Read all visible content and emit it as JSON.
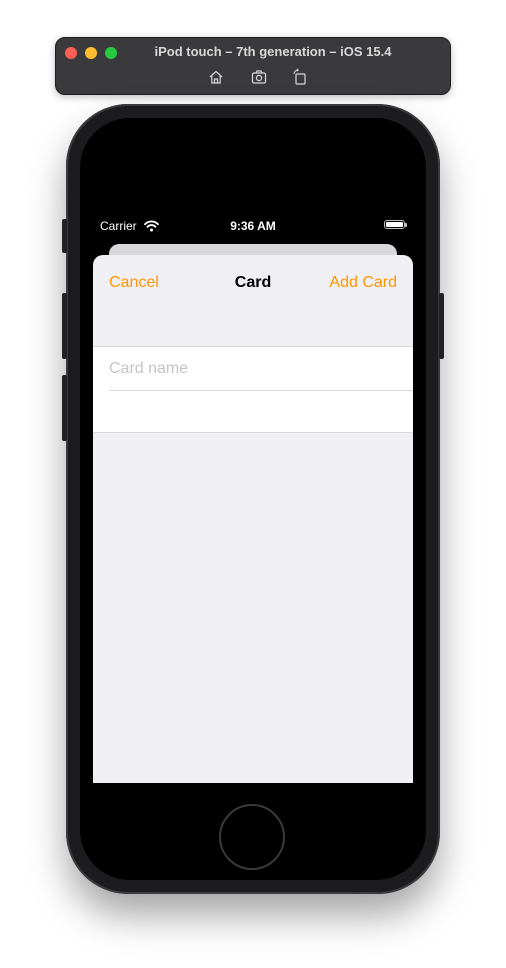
{
  "simulator": {
    "title": "iPod touch – 7th generation – iOS 15.4",
    "tools": [
      "home-icon",
      "screenshot-icon",
      "rotate-icon"
    ]
  },
  "status_bar": {
    "carrier": "Carrier",
    "time": "9:36 AM"
  },
  "nav": {
    "cancel_label": "Cancel",
    "title": "Card",
    "add_label": "Add Card"
  },
  "form": {
    "card_name_placeholder": "Card name",
    "card_name_value": ""
  },
  "colors": {
    "accent": "#ff9500",
    "sheet_background": "#efeff4"
  }
}
